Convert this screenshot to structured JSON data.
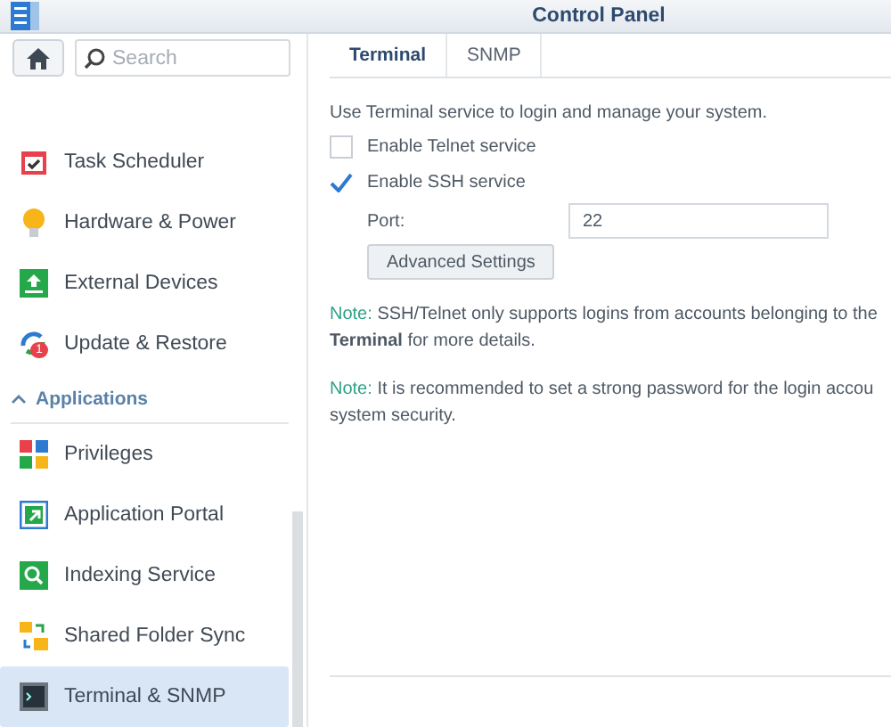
{
  "window": {
    "title": "Control Panel"
  },
  "search": {
    "placeholder": "Search"
  },
  "sidebar": {
    "items": [
      {
        "label": "Task Scheduler",
        "selected": false
      },
      {
        "label": "Hardware & Power",
        "selected": false
      },
      {
        "label": "External Devices",
        "selected": false
      },
      {
        "label": "Update & Restore",
        "badge": "1",
        "selected": false
      },
      {
        "kind": "header",
        "label": "Applications",
        "expanded": true
      },
      {
        "label": "Privileges",
        "selected": false
      },
      {
        "label": "Application Portal",
        "selected": false
      },
      {
        "label": "Indexing Service",
        "selected": false
      },
      {
        "label": "Shared Folder Sync",
        "selected": false
      },
      {
        "label": "Terminal & SNMP",
        "selected": true
      }
    ]
  },
  "tabs": [
    {
      "label": "Terminal",
      "selected": true
    },
    {
      "label": "SNMP",
      "selected": false
    }
  ],
  "description": "Use Terminal service to login and manage your system.",
  "options": [
    {
      "label": "Enable Telnet service",
      "checked": false
    },
    {
      "label": "Enable SSH service",
      "checked": true
    }
  ],
  "port": {
    "label": "Port:",
    "value": "22"
  },
  "advanced_button": "Advanced Settings",
  "notes": [
    {
      "label": "Note:",
      "lines": [
        "SSH/Telnet only supports logins from accounts belonging to the",
        "**Terminal** for more details."
      ]
    },
    {
      "label": "Note:",
      "lines": [
        "It is recommended to set a strong password for the login accou",
        "system security."
      ]
    }
  ]
}
